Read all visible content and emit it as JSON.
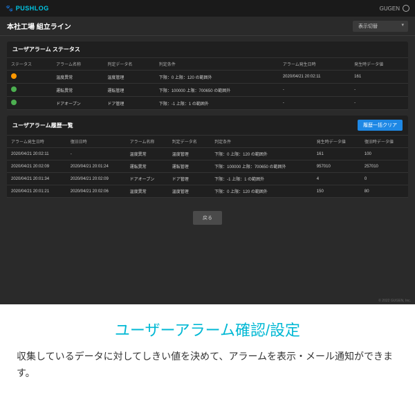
{
  "topbar": {
    "brand": "PUSHLOG",
    "brandIcon": "🐾",
    "right": "GUGEN"
  },
  "page": {
    "title": "本社工場 組立ライン",
    "displaySelect": "表示切替"
  },
  "statusPanel": {
    "title": "ユーザアラーム ステータス",
    "headers": [
      "ステータス",
      "アラーム名称",
      "判定データ名",
      "判定条件",
      "アラーム発生日時",
      "発生時データ値"
    ],
    "rows": [
      {
        "color": "orange",
        "name": "温度異常",
        "dataName": "温度管理",
        "cond": "下限：0 上限：120 の範囲外",
        "time": "2020/04/21 20:02:11",
        "val": "161"
      },
      {
        "color": "green",
        "name": "運転異常",
        "dataName": "運転管理",
        "cond": "下限：100000 上限：700650 の範囲外",
        "time": "-",
        "val": "-"
      },
      {
        "color": "green",
        "name": "ドアオープン",
        "dataName": "ドア管理",
        "cond": "下限：-1 上限：1 の範囲外",
        "time": "-",
        "val": "-"
      }
    ]
  },
  "historyPanel": {
    "title": "ユーザアラーム履歴一覧",
    "clearLabel": "履歴一括クリア",
    "headers": [
      "アラーム発生日時",
      "復旧日時",
      "アラーム名称",
      "判定データ名",
      "判定条件",
      "発生時データ値",
      "復旧時データ値"
    ],
    "rows": [
      {
        "time": "2020/04/21 20:02:11",
        "recover": "-",
        "name": "温度異常",
        "dataName": "温度管理",
        "cond": "下限：0 上限：120 の範囲外",
        "val": "161",
        "rval": "100"
      },
      {
        "time": "2020/04/21 20:02:09",
        "recover": "2020/04/21 20:01:24",
        "name": "運転異常",
        "dataName": "運転管理",
        "cond": "下限：100000 上限：700650 の範囲外",
        "val": "957010",
        "rval": "257010"
      },
      {
        "time": "2020/04/21 20:01:34",
        "recover": "2020/04/21 20:02:09",
        "name": "ドアオープン",
        "dataName": "ドア管理",
        "cond": "下限：-1 上限：1 の範囲外",
        "val": "4",
        "rval": "0"
      },
      {
        "time": "2020/04/21 20:01:21",
        "recover": "2020/04/21 20:02:06",
        "name": "温度異常",
        "dataName": "温度管理",
        "cond": "下限：0 上限：120 の範囲外",
        "val": "150",
        "rval": "80"
      }
    ]
  },
  "back": "戻る",
  "copyright": "© 2022 GUGEN, Inc.",
  "caption": {
    "title": "ユーザーアラーム確認/設定",
    "desc": "収集しているデータに対してしきい値を決めて、アラームを表示・メール通知ができます。"
  }
}
